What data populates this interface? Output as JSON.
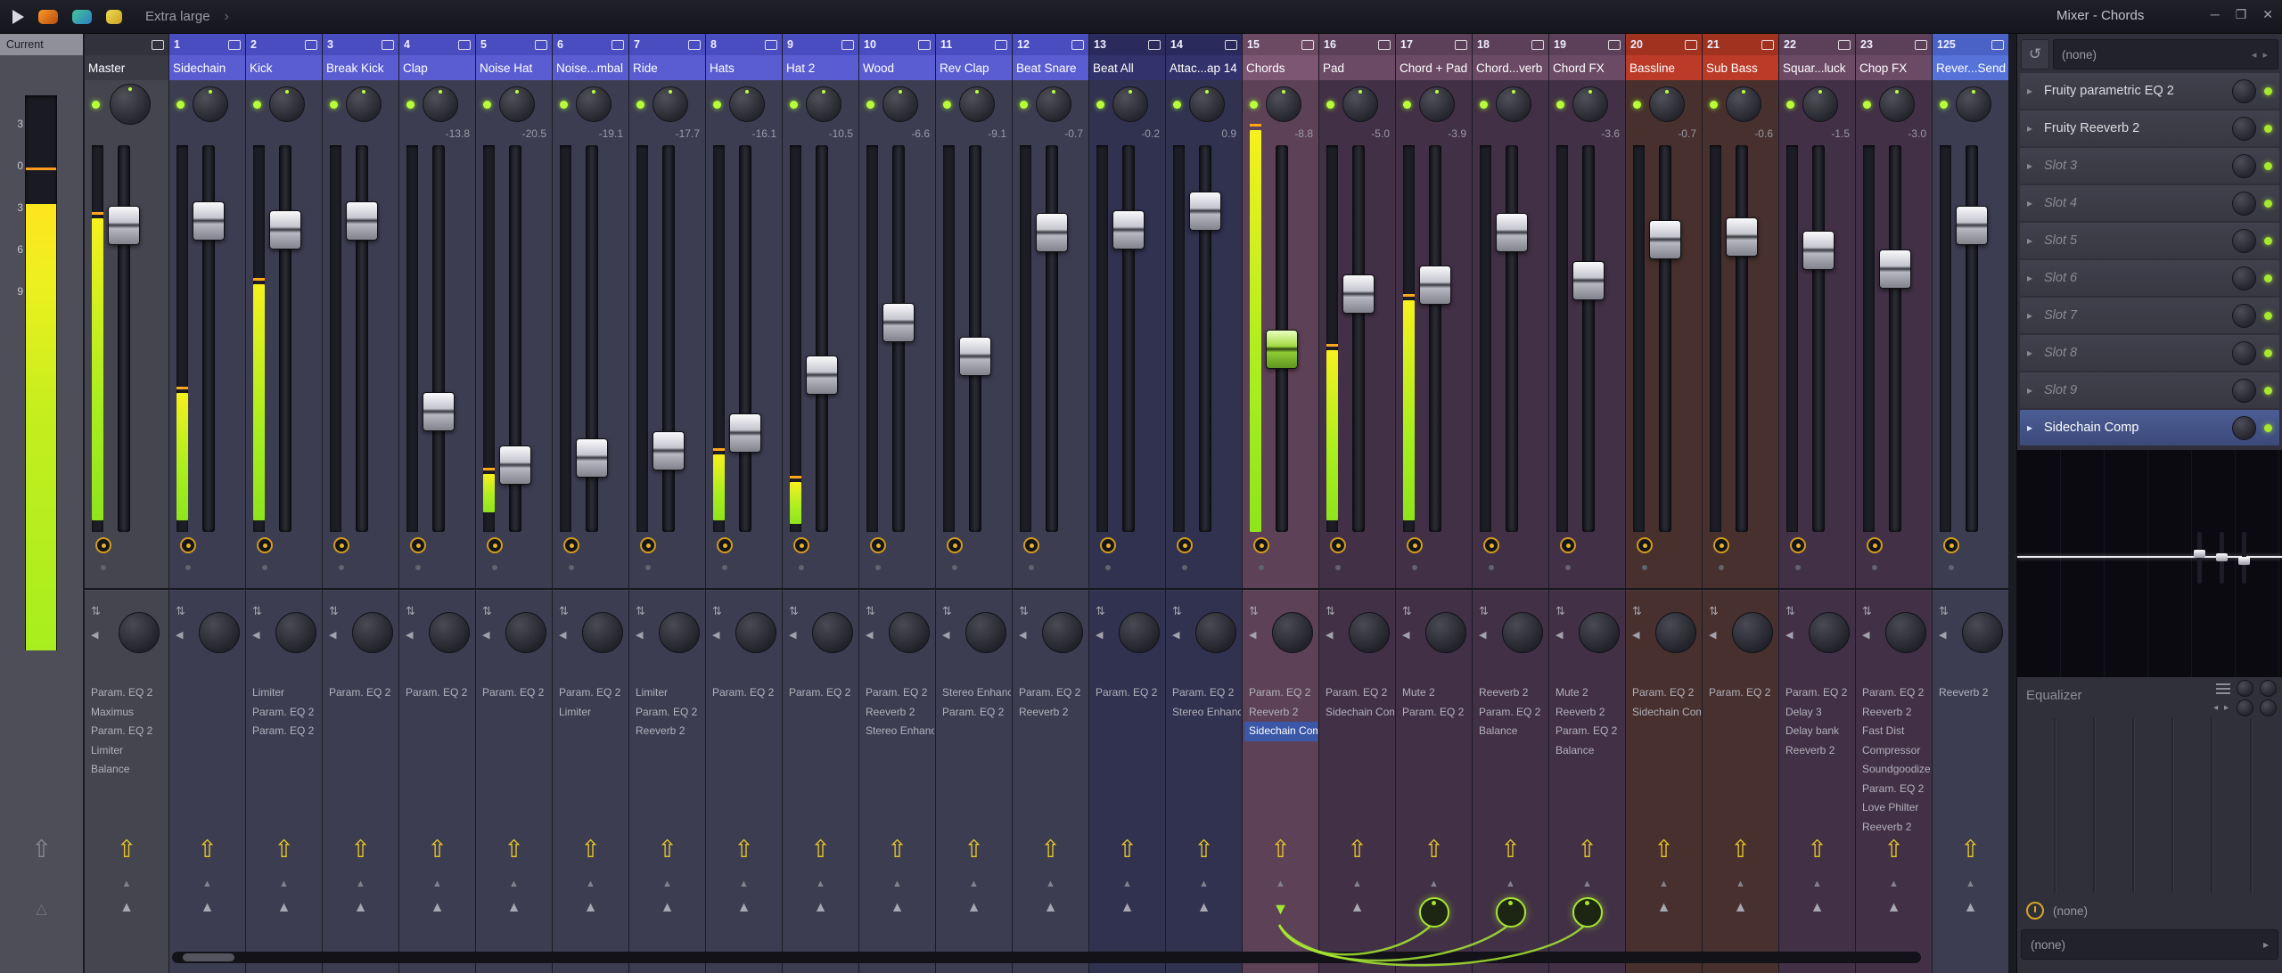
{
  "window": {
    "title": "Mixer - Chords",
    "controls": {
      "minimize": "─",
      "maximize": "❐",
      "close": "✕"
    }
  },
  "toolbar": {
    "layout_label": "Extra large",
    "chevron": "›"
  },
  "icons": {
    "link_arrow": "⇧",
    "tri": "▲",
    "tri_down": "▼",
    "hollow_tri": "△",
    "slot_arrow": "▸",
    "chevron": "›",
    "back": "↺",
    "select_arrows": "◂ ▸",
    "updown": "⇅",
    "stereo": "◀"
  },
  "colors": {
    "meter_green": "#a8ee1e",
    "meter_yellow": "#ffe51e",
    "peak_orange": "#ff9c20",
    "accent_yellow": "#e8c826",
    "route_green": "#a6e632",
    "selected_blue": "#3a57a8",
    "groups": {
      "blue": "#5a5dd2",
      "navy": "#32326c",
      "purple": "#6b4a66",
      "purple_selected": "#7d5674",
      "red": "#bc3a28",
      "send": "#5673da",
      "master": "#3a3a45"
    }
  },
  "current_strip": {
    "label": "Current",
    "scale": [
      "3",
      "0",
      "3",
      "6",
      "9"
    ]
  },
  "tracks": [
    {
      "num": "",
      "name": "Master",
      "master": true,
      "group": "master",
      "db": "",
      "fader": 0.175,
      "meter": [
        0.19,
        0.97
      ],
      "fx": [
        {
          "label": "Param. EQ 2"
        },
        {
          "label": "Maximus"
        },
        {
          "label": "Param. EQ 2"
        },
        {
          "label": "Limiter"
        },
        {
          "label": "Balance"
        }
      ]
    },
    {
      "num": "1",
      "name": "Sidechain",
      "group": "blue",
      "db": "",
      "fader": 0.162,
      "meter": [
        0.64,
        0.97
      ],
      "fx": []
    },
    {
      "num": "2",
      "name": "Kick",
      "group": "blue",
      "db": "",
      "fader": 0.187,
      "meter": [
        0.36,
        0.97
      ],
      "fx": [
        {
          "label": "Limiter"
        },
        {
          "label": "Param. EQ 2"
        },
        {
          "label": "Param. EQ 2"
        }
      ]
    },
    {
      "num": "3",
      "name": "Break Kick",
      "group": "blue",
      "db": "",
      "fader": 0.162,
      "fx": [
        {
          "label": "Param. EQ 2"
        }
      ]
    },
    {
      "num": "4",
      "name": "Clap",
      "group": "blue",
      "db": "-13.8",
      "fader": 0.71,
      "fx": [
        {
          "label": "Param. EQ 2"
        }
      ]
    },
    {
      "num": "5",
      "name": "Noise Hat",
      "group": "blue",
      "db": "-20.5",
      "fader": 0.865,
      "meter": [
        0.85,
        0.95
      ],
      "fx": [
        {
          "label": "Param. EQ 2"
        }
      ]
    },
    {
      "num": "6",
      "name": "Noise...mbal",
      "group": "blue",
      "db": "-19.1",
      "fader": 0.844,
      "fx": [
        {
          "label": "Param. EQ 2"
        },
        {
          "label": "Limiter"
        }
      ]
    },
    {
      "num": "7",
      "name": "Ride",
      "group": "blue",
      "db": "-17.7",
      "fader": 0.823,
      "fx": [
        {
          "label": "Limiter"
        },
        {
          "label": "Param. EQ 2"
        },
        {
          "label": "Reeverb 2"
        }
      ]
    },
    {
      "num": "8",
      "name": "Hats",
      "group": "blue",
      "db": "-16.1",
      "fader": 0.773,
      "meter": [
        0.8,
        0.97
      ],
      "fx": [
        {
          "label": "Param. EQ 2"
        }
      ]
    },
    {
      "num": "9",
      "name": "Hat 2",
      "group": "blue",
      "db": "-10.5",
      "fader": 0.605,
      "meter": [
        0.87,
        0.98
      ],
      "fx": [
        {
          "label": "Param. EQ 2"
        }
      ]
    },
    {
      "num": "10",
      "name": "Wood",
      "group": "blue",
      "db": "-6.6",
      "fader": 0.455,
      "fx": [
        {
          "label": "Param. EQ 2"
        },
        {
          "label": "Reeverb 2"
        },
        {
          "label": "Stereo Enhancer"
        }
      ]
    },
    {
      "num": "11",
      "name": "Rev Clap",
      "group": "blue",
      "db": "-9.1",
      "fader": 0.551,
      "fx": [
        {
          "label": "Stereo Enhancer"
        },
        {
          "label": "Param. EQ 2"
        }
      ]
    },
    {
      "num": "12",
      "name": "Beat Snare",
      "group": "blue",
      "db": "-0.7",
      "fader": 0.195,
      "fx": [
        {
          "label": "Param. EQ 2"
        },
        {
          "label": "Reeverb 2"
        }
      ]
    },
    {
      "num": "13",
      "name": "Beat All",
      "group": "navy",
      "db": "-0.2",
      "fader": 0.187,
      "fx": [
        {
          "label": "Param. EQ 2"
        }
      ]
    },
    {
      "num": "14",
      "name": "Attac...ap 14",
      "group": "navy",
      "db": "0.9",
      "fader": 0.133,
      "fx": [
        {
          "label": "Param. EQ 2"
        },
        {
          "label": "Stereo Enhancer"
        }
      ]
    },
    {
      "num": "15",
      "name": "Chords",
      "group": "purpleSel",
      "db": "-8.8",
      "fader": 0.531,
      "fader_green": true,
      "meter": [
        -0.04,
        1.0
      ],
      "route": "source",
      "fx": [
        {
          "label": "Param. EQ 2"
        },
        {
          "label": "Reeverb 2"
        },
        {
          "label": "Sidechain Comp",
          "sel": true
        }
      ]
    },
    {
      "num": "16",
      "name": "Pad",
      "group": "purple",
      "db": "-5.0",
      "fader": 0.372,
      "meter": [
        0.53,
        0.97
      ],
      "fx": [
        {
          "label": "Param. EQ 2"
        },
        {
          "label": "Sidechain Comp"
        }
      ]
    },
    {
      "num": "17",
      "name": "Chord + Pad",
      "group": "purple",
      "db": "-3.9",
      "fader": 0.346,
      "meter": [
        0.4,
        0.97
      ],
      "route": "knob",
      "fx": [
        {
          "label": "Mute 2"
        },
        {
          "label": "Param. EQ 2"
        }
      ]
    },
    {
      "num": "18",
      "name": "Chord...verb",
      "group": "purple",
      "db": "",
      "fader": 0.195,
      "route": "knob",
      "fx": [
        {
          "label": "Reeverb 2"
        },
        {
          "label": "Param. EQ 2"
        },
        {
          "label": "Balance"
        }
      ]
    },
    {
      "num": "19",
      "name": "Chord FX",
      "group": "purple",
      "db": "-3.6",
      "fader": 0.333,
      "route": "knob",
      "fx": [
        {
          "label": "Mute 2"
        },
        {
          "label": "Reeverb 2"
        },
        {
          "label": "Param. EQ 2"
        },
        {
          "label": "Balance"
        }
      ]
    },
    {
      "num": "20",
      "name": "Bassline",
      "group": "red",
      "db": "-0.7",
      "fader": 0.216,
      "fx": [
        {
          "label": "Param. EQ 2"
        },
        {
          "label": "Sidechain Comp"
        }
      ]
    },
    {
      "num": "21",
      "name": "Sub Bass",
      "group": "red",
      "db": "-0.6",
      "fader": 0.208,
      "fx": [
        {
          "label": "Param. EQ 2"
        }
      ]
    },
    {
      "num": "22",
      "name": "Squar...luck",
      "group": "purple",
      "db": "-1.5",
      "fader": 0.246,
      "fx": [
        {
          "label": "Param. EQ 2"
        },
        {
          "label": "Delay 3"
        },
        {
          "label": "Delay bank"
        },
        {
          "label": "Reeverb 2"
        }
      ]
    },
    {
      "num": "23",
      "name": "Chop FX",
      "group": "purple",
      "db": "-3.0",
      "fader": 0.3,
      "fx": [
        {
          "label": "Param. EQ 2"
        },
        {
          "label": "Reeverb 2"
        },
        {
          "label": "Fast Dist"
        },
        {
          "label": "Compressor"
        },
        {
          "label": "Soundgoodizer"
        },
        {
          "label": "Param. EQ 2"
        },
        {
          "label": "Love Philter"
        },
        {
          "label": "Reeverb 2"
        }
      ]
    },
    {
      "num": "125",
      "name": "Rever...Send",
      "group": "send",
      "db": "",
      "fader": 0.175,
      "fx": [
        {
          "label": "Reeverb 2"
        }
      ]
    }
  ],
  "panel": {
    "top_select": "(none)",
    "slots": [
      {
        "label": "Fruity parametric EQ 2",
        "filled": true
      },
      {
        "label": "Fruity Reeverb 2",
        "filled": true
      },
      {
        "label": "Slot 3",
        "filled": false
      },
      {
        "label": "Slot 4",
        "filled": false
      },
      {
        "label": "Slot 5",
        "filled": false
      },
      {
        "label": "Slot 6",
        "filled": false
      },
      {
        "label": "Slot 7",
        "filled": false
      },
      {
        "label": "Slot 8",
        "filled": false
      },
      {
        "label": "Slot 9",
        "filled": false
      },
      {
        "label": "Sidechain Comp",
        "filled": true,
        "selected": true
      }
    ],
    "equalizer_label": "Equalizer",
    "bottom_rows": [
      {
        "label": "(none)"
      },
      {
        "label": "(none)"
      }
    ]
  }
}
